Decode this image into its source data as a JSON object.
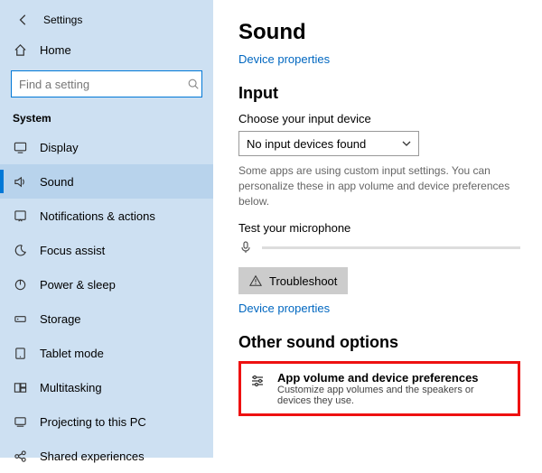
{
  "app": {
    "title": "Settings"
  },
  "sidebar": {
    "home": "Home",
    "search_placeholder": "Find a setting",
    "section": "System",
    "items": [
      {
        "label": "Display"
      },
      {
        "label": "Sound"
      },
      {
        "label": "Notifications & actions"
      },
      {
        "label": "Focus assist"
      },
      {
        "label": "Power & sleep"
      },
      {
        "label": "Storage"
      },
      {
        "label": "Tablet mode"
      },
      {
        "label": "Multitasking"
      },
      {
        "label": "Projecting to this PC"
      },
      {
        "label": "Shared experiences"
      }
    ]
  },
  "main": {
    "title": "Sound",
    "device_props_link": "Device properties",
    "input_heading": "Input",
    "input_choose_label": "Choose your input device",
    "input_selected": "No input devices found",
    "input_hint": "Some apps are using custom input settings. You can personalize these in app volume and device preferences below.",
    "test_mic_label": "Test your microphone",
    "troubleshoot_label": "Troubleshoot",
    "device_props_link2": "Device properties",
    "other_heading": "Other sound options",
    "other_option_title": "App volume and device preferences",
    "other_option_sub": "Customize app volumes and the speakers or devices they use."
  }
}
